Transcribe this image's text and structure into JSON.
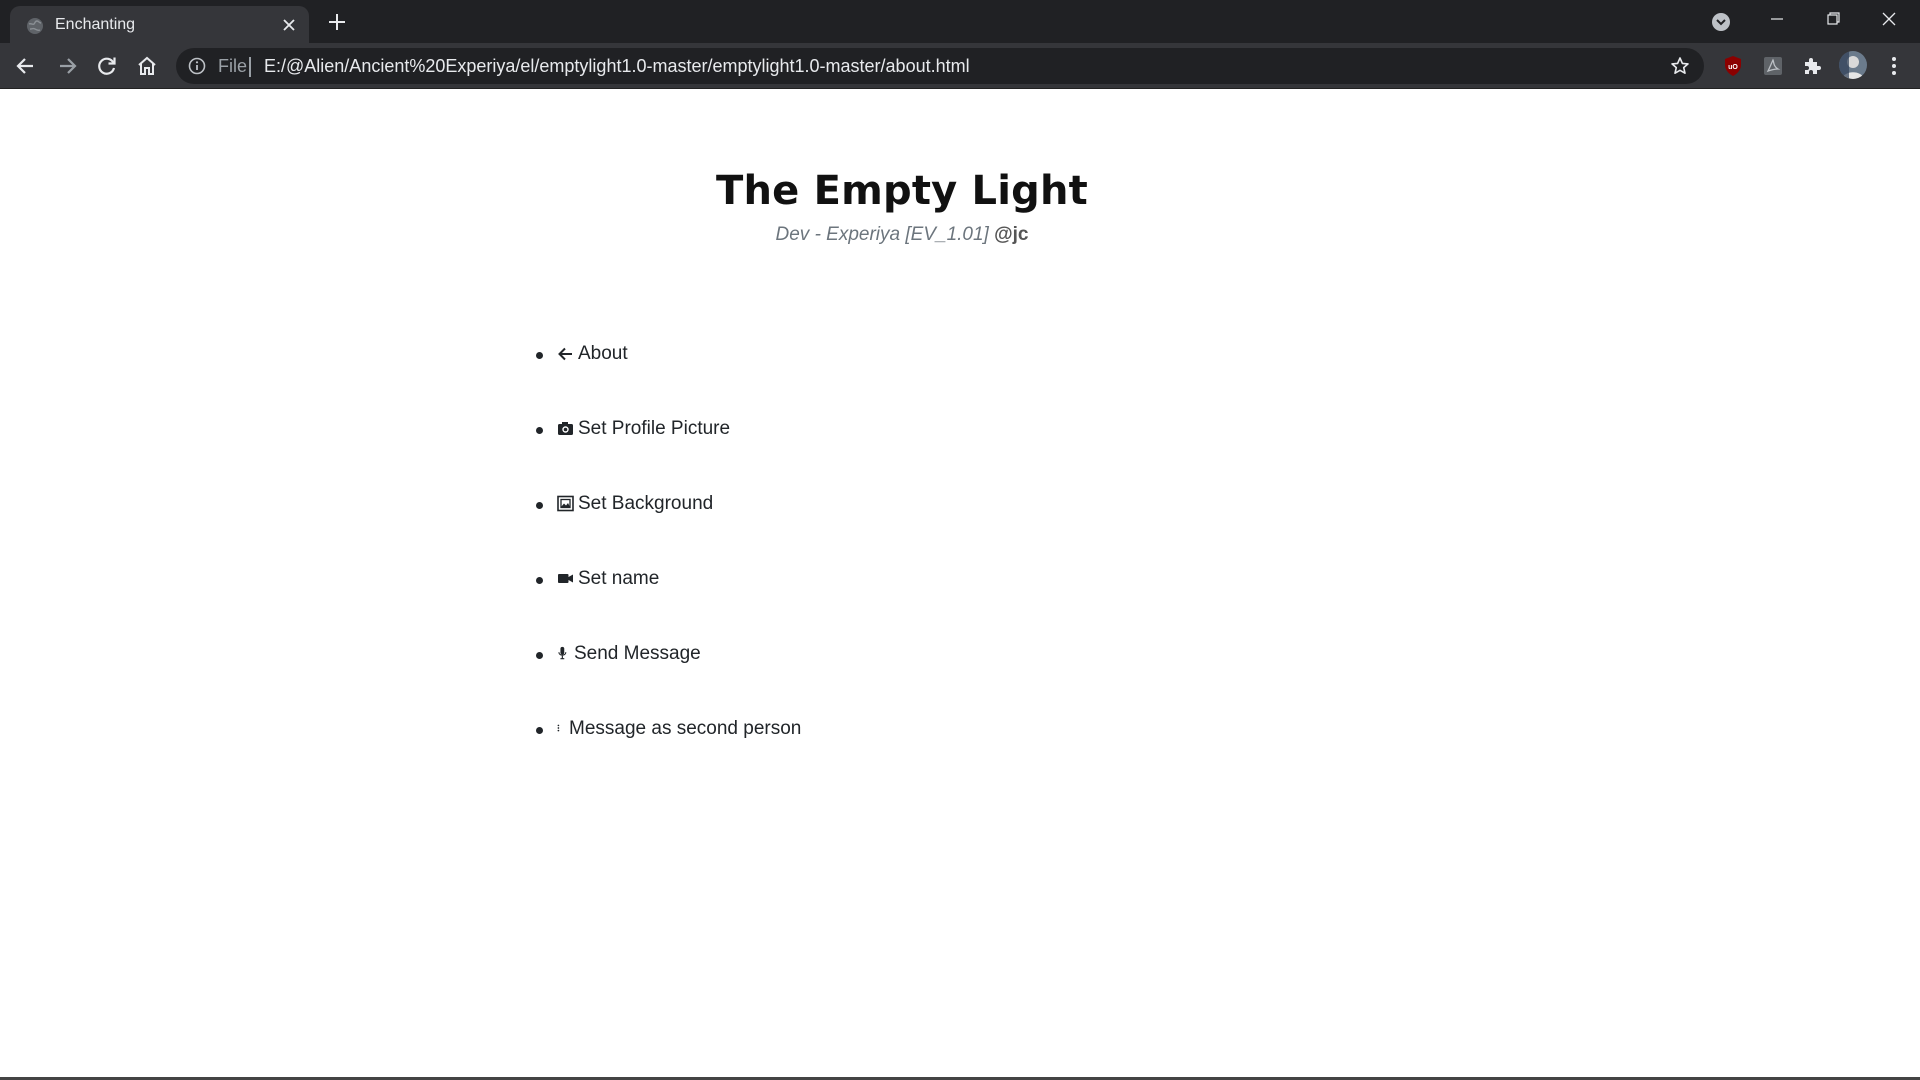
{
  "browser": {
    "tab_title": "Enchanting",
    "omnibox": {
      "scheme_label": "File",
      "url": "E:/@Alien/Ancient%20Experiya/el/emptylight1.0-master/emptylight1.0-master/about.html"
    },
    "icons": {
      "back": "arrow-left-icon",
      "forward": "arrow-right-icon",
      "reload": "reload-icon",
      "home": "home-icon",
      "info": "info-icon",
      "bookmark": "star-icon",
      "extensions": [
        "ublock-icon",
        "pdf-icon",
        "puzzle-icon"
      ],
      "menu": "kebab-menu-icon"
    }
  },
  "page": {
    "title": "The Empty Light",
    "subtitle_italic": "Dev - Experiya [EV_1.01]",
    "subtitle_handle": "@jc",
    "menu": [
      {
        "icon": "arrow-left-icon",
        "label": "About"
      },
      {
        "icon": "camera-icon",
        "label": "Set Profile Picture"
      },
      {
        "icon": "image-icon",
        "label": "Set Background"
      },
      {
        "icon": "video-camera-icon",
        "label": "Set name"
      },
      {
        "icon": "microphone-icon",
        "label": "Send Message"
      },
      {
        "icon": "vertical-ellipsis-icon",
        "label": "Message as second person"
      }
    ]
  },
  "colors": {
    "chrome_dark": "#202124",
    "chrome_toolbar": "#35363a",
    "page_bg": "#ffffff",
    "text": "#212529",
    "muted": "#6c757d"
  }
}
